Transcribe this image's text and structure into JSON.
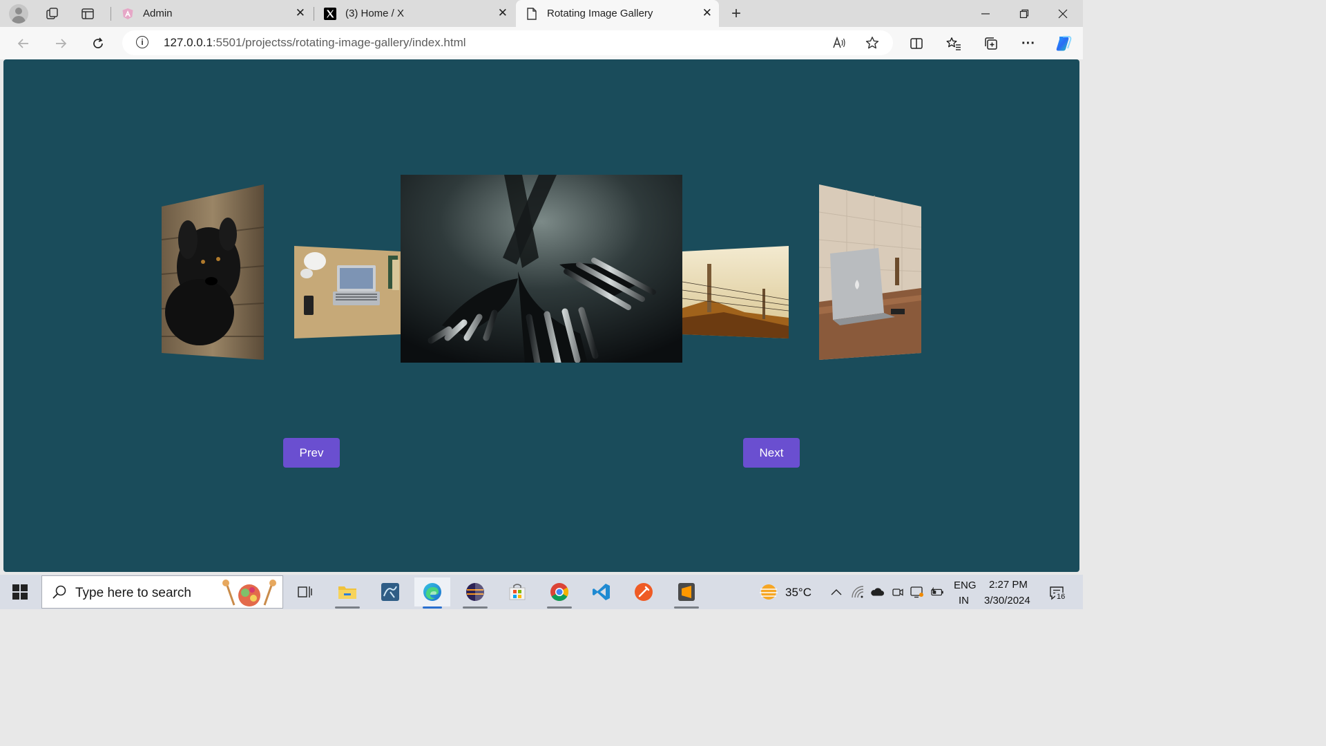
{
  "browser": {
    "tabs": [
      {
        "title": "Admin",
        "icon": "angular-icon"
      },
      {
        "title": "(3) Home / X",
        "icon": "x-logo-icon"
      },
      {
        "title": "Rotating Image Gallery",
        "icon": "page-icon"
      }
    ],
    "address": {
      "host": "127.0.0.1",
      "path": ":5501/projectss/rotating-image-gallery/index.html"
    }
  },
  "page": {
    "prev_label": "Prev",
    "next_label": "Next",
    "images": [
      "black-dog-photo",
      "laptop-desk-photo",
      "forks-photo",
      "fence-field-photo",
      "macbook-table-photo"
    ],
    "colors": {
      "background": "#1a4c5b",
      "button": "#6a4fd0"
    }
  },
  "taskbar": {
    "search_placeholder": "Type here to search",
    "weather": "35°C",
    "lang_top": "ENG",
    "lang_bottom": "IN",
    "time": "2:27 PM",
    "date": "3/30/2024",
    "notification_count": "16"
  }
}
